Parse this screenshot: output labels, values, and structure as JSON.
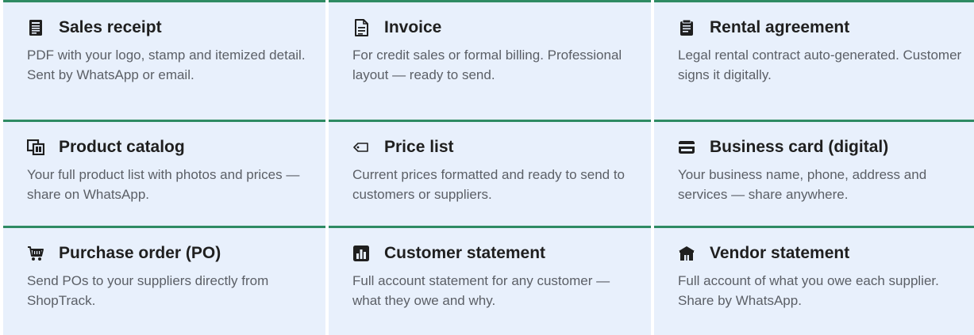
{
  "cards": [
    {
      "icon": "receipt-icon",
      "title": "Sales receipt",
      "description": "PDF with your logo, stamp and itemized detail. Sent by WhatsApp or email."
    },
    {
      "icon": "document-icon",
      "title": "Invoice",
      "description": "For credit sales or formal billing. Professional layout — ready to send."
    },
    {
      "icon": "clipboard-icon",
      "title": "Rental agreement",
      "description": "Legal rental contract auto-generated. Customer signs it digitally."
    },
    {
      "icon": "catalog-icon",
      "title": "Product catalog",
      "description": "Your full product list with photos and prices — share on WhatsApp."
    },
    {
      "icon": "price-tag-icon",
      "title": "Price list",
      "description": "Current prices formatted and ready to send to customers or suppliers."
    },
    {
      "icon": "card-icon",
      "title": "Business card (digital)",
      "description": "Your business name, phone, address and services — share anywhere."
    },
    {
      "icon": "cart-icon",
      "title": "Purchase order (PO)",
      "description": "Send POs to your suppliers directly from ShopTrack."
    },
    {
      "icon": "bar-chart-icon",
      "title": "Customer statement",
      "description": "Full account statement for any customer — what they owe and why."
    },
    {
      "icon": "building-icon",
      "title": "Vendor statement",
      "description": "Full account of what you owe each supplier. Share by WhatsApp."
    }
  ]
}
